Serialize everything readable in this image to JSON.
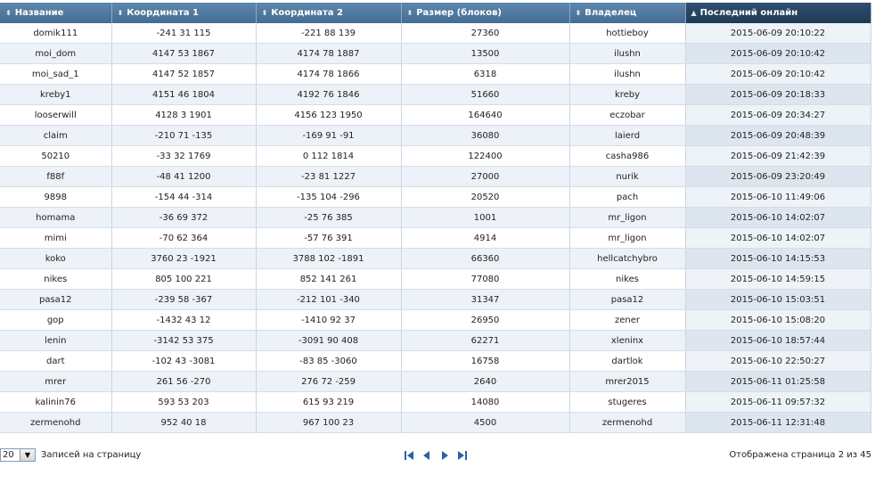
{
  "columns": [
    {
      "label": "Название",
      "sorted": false
    },
    {
      "label": "Координата 1",
      "sorted": false
    },
    {
      "label": "Координата 2",
      "sorted": false
    },
    {
      "label": "Размер (блоков)",
      "sorted": false
    },
    {
      "label": "Владелец",
      "sorted": false
    },
    {
      "label": "Последний онлайн",
      "sorted": true
    }
  ],
  "sort_icon": "sort-icon",
  "rows": [
    [
      "domik111",
      "-241 31 115",
      "-221 88 139",
      "27360",
      "hottieboy",
      "2015-06-09 20:10:22"
    ],
    [
      "moi_dom",
      "4147 53 1867",
      "4174 78 1887",
      "13500",
      "ilushn",
      "2015-06-09 20:10:42"
    ],
    [
      "moi_sad_1",
      "4147 52 1857",
      "4174 78 1866",
      "6318",
      "ilushn",
      "2015-06-09 20:10:42"
    ],
    [
      "kreby1",
      "4151 46 1804",
      "4192 76 1846",
      "51660",
      "kreby",
      "2015-06-09 20:18:33"
    ],
    [
      "looserwill",
      "4128 3 1901",
      "4156 123 1950",
      "164640",
      "eczobar",
      "2015-06-09 20:34:27"
    ],
    [
      "claim",
      "-210 71 -135",
      "-169 91 -91",
      "36080",
      "laierd",
      "2015-06-09 20:48:39"
    ],
    [
      "50210",
      "-33 32 1769",
      "0 112 1814",
      "122400",
      "casha986",
      "2015-06-09 21:42:39"
    ],
    [
      "f88f",
      "-48 41 1200",
      "-23 81 1227",
      "27000",
      "nurik",
      "2015-06-09 23:20:49"
    ],
    [
      "9898",
      "-154 44 -314",
      "-135 104 -296",
      "20520",
      "pach",
      "2015-06-10 11:49:06"
    ],
    [
      "homama",
      "-36 69 372",
      "-25 76 385",
      "1001",
      "mr_ligon",
      "2015-06-10 14:02:07"
    ],
    [
      "mimi",
      "-70 62 364",
      "-57 76 391",
      "4914",
      "mr_ligon",
      "2015-06-10 14:02:07"
    ],
    [
      "koko",
      "3760 23 -1921",
      "3788 102 -1891",
      "66360",
      "hellcatchybro",
      "2015-06-10 14:15:53"
    ],
    [
      "nikes",
      "805 100 221",
      "852 141 261",
      "77080",
      "nikes",
      "2015-06-10 14:59:15"
    ],
    [
      "pasa12",
      "-239 58 -367",
      "-212 101 -340",
      "31347",
      "pasa12",
      "2015-06-10 15:03:51"
    ],
    [
      "gop",
      "-1432 43 12",
      "-1410 92 37",
      "26950",
      "zener",
      "2015-06-10 15:08:20"
    ],
    [
      "lenin",
      "-3142 53 375",
      "-3091 90 408",
      "62271",
      "xleninx",
      "2015-06-10 18:57:44"
    ],
    [
      "dart",
      "-102 43 -3081",
      "-83 85 -3060",
      "16758",
      "dartlok",
      "2015-06-10 22:50:27"
    ],
    [
      "mrer",
      "261 56 -270",
      "276 72 -259",
      "2640",
      "mrer2015",
      "2015-06-11 01:25:58"
    ],
    [
      "kalinin76",
      "593 53 203",
      "615 93 219",
      "14080",
      "stugeres",
      "2015-06-11 09:57:32"
    ],
    [
      "zermenohd",
      "952 40 18",
      "967 100 23",
      "4500",
      "zermenohd",
      "2015-06-11 12:31:48"
    ]
  ],
  "pager": {
    "per_page_value": "20",
    "per_page_label": "Записей на страницу",
    "page_info": "Отображена страница 2 из 45",
    "nav_icons": [
      "first-page-icon",
      "prev-page-icon",
      "next-page-icon",
      "last-page-icon"
    ],
    "icon_color": "#2a62a8"
  }
}
